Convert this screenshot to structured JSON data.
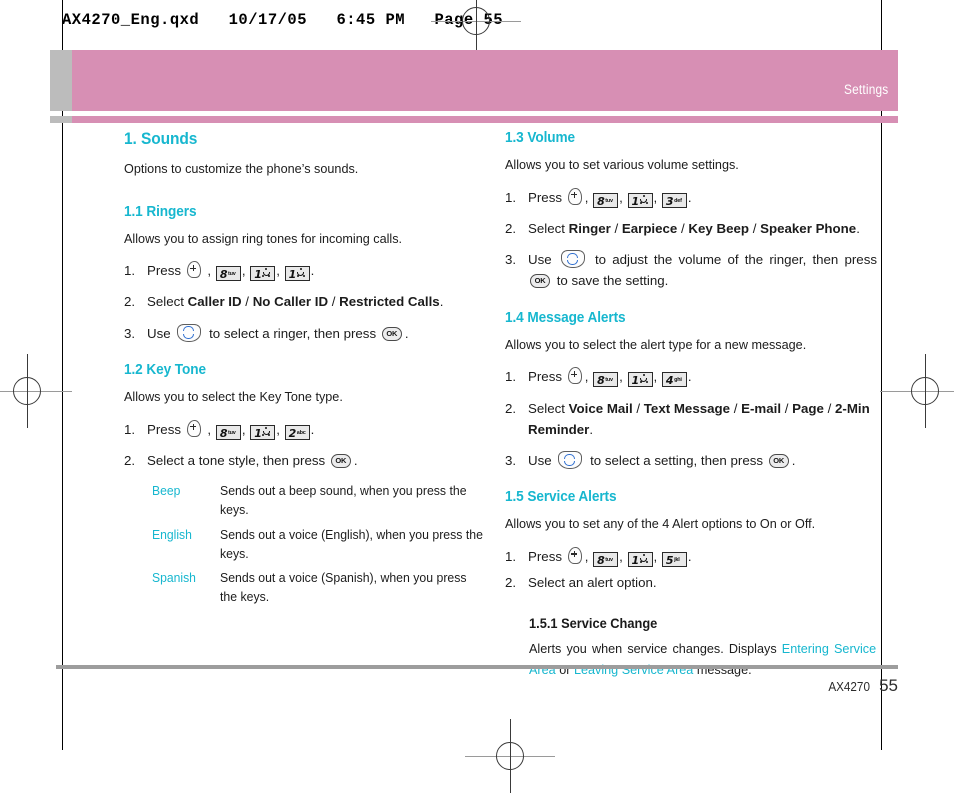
{
  "print_header": "AX4270_Eng.qxd   10/17/05   6:45 PM   Page 55",
  "banner": {
    "label": "Settings"
  },
  "footer": {
    "model": "AX4270",
    "page": "55"
  },
  "icons": {
    "menu_key": "menu-key-icon",
    "nav_key": "navigation-key-icon",
    "ok_key": "ok-key-icon",
    "ok_label": "OK",
    "key_1_digit": "1",
    "key_2_digit": "2",
    "key_2_letters": "abc",
    "key_3_digit": "3",
    "key_3_letters": "def",
    "key_4_digit": "4",
    "key_4_letters": "ghi",
    "key_5_digit": "5",
    "key_5_letters": "jkl",
    "key_8_digit": "8",
    "key_8_letters": "tuv"
  },
  "left_column": {
    "section": {
      "heading": "1. Sounds",
      "intro": "Options to customize the phone’s sounds."
    },
    "ringers": {
      "heading": "1.1 Ringers",
      "intro": "Allows you to assign ring tones for incoming calls.",
      "step1_num": "1.",
      "step1_label": "Press",
      "step2_num": "2.",
      "step2_prefix": "Select ",
      "step2_opt1": "Caller ID",
      "step2_sep1": " / ",
      "step2_opt2": "No Caller ID",
      "step2_sep2": " / ",
      "step2_opt3": "Restricted Calls",
      "step2_suffix": ".",
      "step3_num": "3.",
      "step3_a": "Use",
      "step3_b": "to select a ringer, then press",
      "step3_c": "."
    },
    "keytone": {
      "heading": "1.2 Key Tone",
      "intro": "Allows you to select the Key Tone type.",
      "step1_num": "1.",
      "step1_label": "Press",
      "step2_num": "2.",
      "step2_a": "Select a tone style, then press",
      "step2_b": ".",
      "options": [
        {
          "term": "Beep",
          "desc": "Sends out a beep sound, when you press the keys."
        },
        {
          "term": "English",
          "desc": "Sends out a voice (English), when you press the keys."
        },
        {
          "term": "Spanish",
          "desc": "Sends out a voice (Spanish), when you press the keys."
        }
      ]
    }
  },
  "right_column": {
    "volume": {
      "heading": "1.3 Volume",
      "intro": "Allows you to set various volume settings.",
      "step1_num": "1.",
      "step1_label": "Press",
      "step2_num": "2.",
      "step2_prefix": "Select ",
      "step2_opt1": "Ringer",
      "step2_sep1": " / ",
      "step2_opt2": "Earpiece",
      "step2_sep2": " / ",
      "step2_opt3": "Key Beep",
      "step2_sep3": " / ",
      "step2_opt4": "Speaker Phone",
      "step2_suffix": ".",
      "step3_num": "3.",
      "step3_a": "Use",
      "step3_b": "to adjust the volume of the ringer, then press",
      "step3_c": "to save the setting."
    },
    "message_alerts": {
      "heading": "1.4 Message Alerts",
      "intro": "Allows you to select the alert type for a new message.",
      "step1_num": "1.",
      "step1_label": "Press",
      "step2_num": "2.",
      "step2_prefix": "Select ",
      "step2_opt1": "Voice Mail",
      "step2_sep1": " / ",
      "step2_opt2": "Text Message",
      "step2_sep2": " / ",
      "step2_opt3": "E-mail",
      "step2_sep3": " / ",
      "step2_opt4": "Page",
      "step2_sep4": " / ",
      "step2_opt5": "2-Min Reminder",
      "step2_suffix": ".",
      "step3_num": "3.",
      "step3_a": "Use",
      "step3_b": "to select a setting, then press",
      "step3_c": "."
    },
    "service_alerts": {
      "heading": "1.5 Service Alerts",
      "intro": "Allows you to set any of the 4 Alert options to On or Off.",
      "step1_num": "1.",
      "step1_label": "Press",
      "step2_num": "2.",
      "step2_text": "Select an alert option.",
      "service_change": {
        "heading": "1.5.1 Service Change",
        "text_a": "Alerts you when service changes. Displays ",
        "highlight_1": "Entering Service Area",
        "text_b": " or ",
        "highlight_2": "Leaving Service Area",
        "text_c": " message."
      }
    }
  }
}
